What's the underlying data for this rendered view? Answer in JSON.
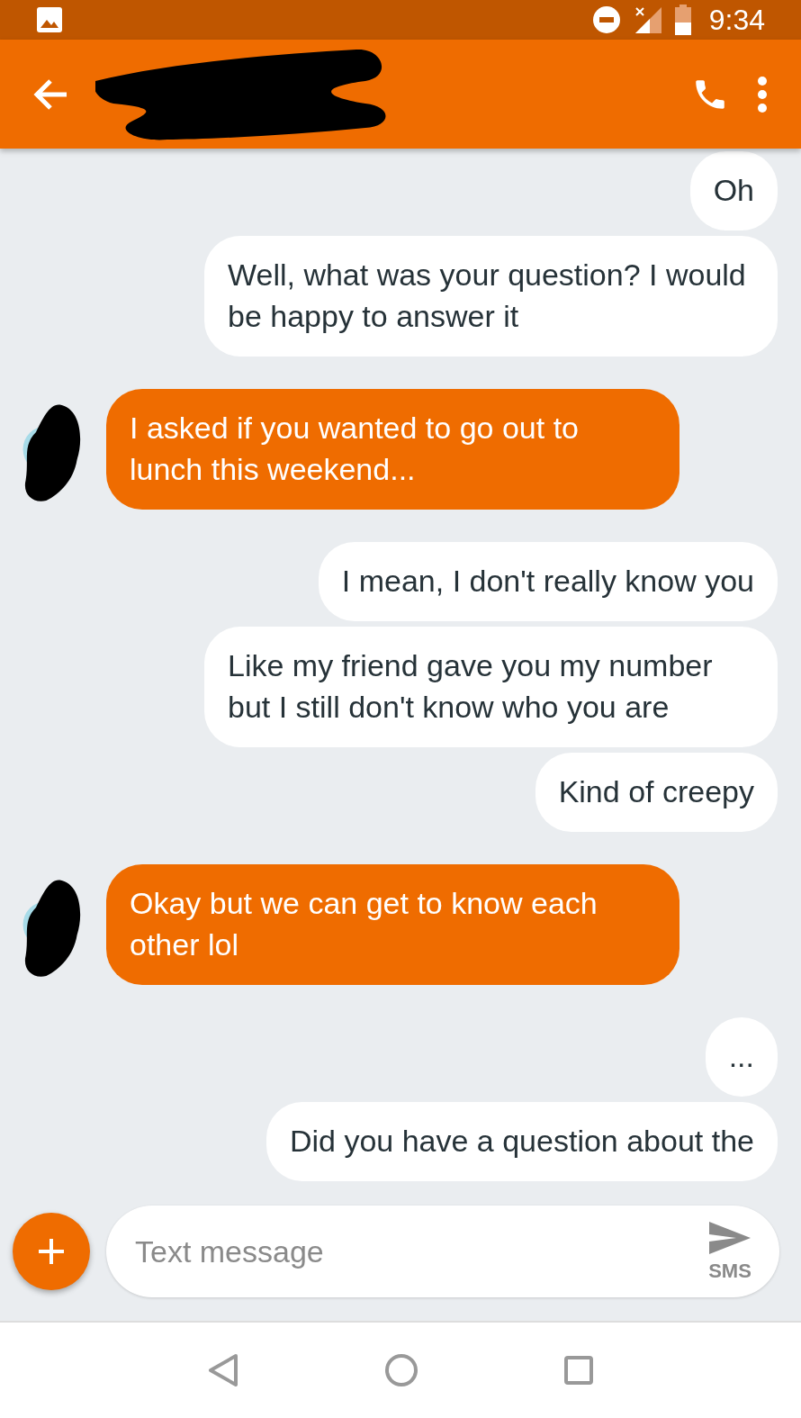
{
  "status_bar": {
    "time": "9:34"
  },
  "messages": [
    {
      "kind": "outgoing",
      "text": "Oh"
    },
    {
      "kind": "outgoing",
      "text": "Well, what was your question? I would be happy to answer it"
    },
    {
      "kind": "incoming",
      "text": "I asked if you wanted to go out to lunch this weekend..."
    },
    {
      "kind": "outgoing",
      "text": "I mean, I don't really know you"
    },
    {
      "kind": "outgoing",
      "text": "Like my friend gave you my number but I still don't know who you are"
    },
    {
      "kind": "outgoing",
      "text": "Kind of creepy"
    },
    {
      "kind": "incoming",
      "text": "Okay but we can get to know each other lol"
    },
    {
      "kind": "outgoing",
      "text": "..."
    },
    {
      "kind": "outgoing",
      "text": "Did you have a question about the"
    }
  ],
  "compose": {
    "placeholder": "Text message",
    "send_label": "SMS"
  }
}
